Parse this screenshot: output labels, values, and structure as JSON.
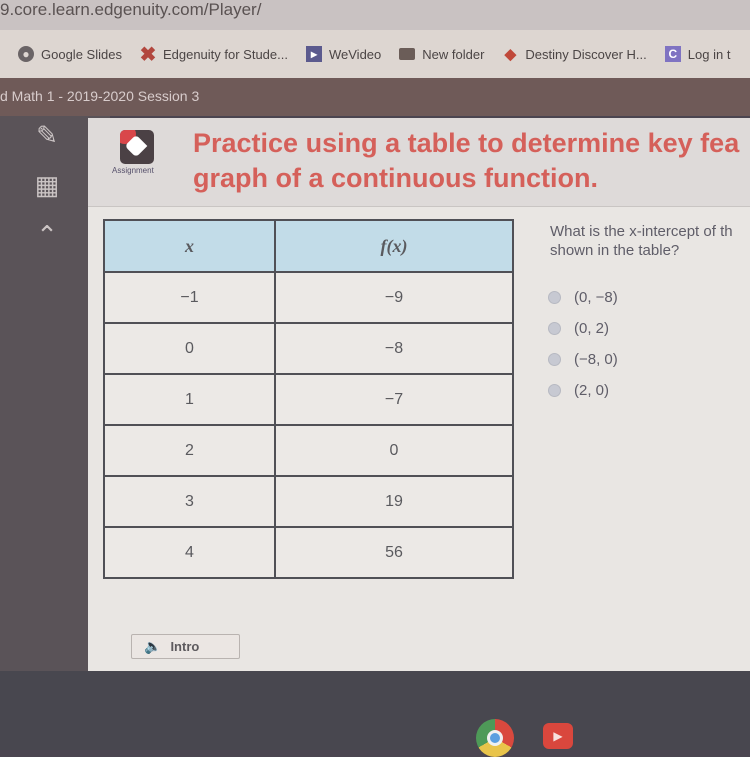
{
  "browser": {
    "url": "9.core.learn.edgenuity.com/Player/",
    "bookmarks": [
      {
        "label": "Google Slides",
        "icon": "google-slides-icon"
      },
      {
        "label": "Edgenuity for Stude...",
        "icon": "edgenuity-icon"
      },
      {
        "label": "WeVideo",
        "icon": "wevideo-icon"
      },
      {
        "label": "New folder",
        "icon": "folder-icon"
      },
      {
        "label": "Destiny Discover H...",
        "icon": "destiny-icon"
      },
      {
        "label": "Log in t",
        "icon": "clever-icon",
        "glyph": "C"
      }
    ]
  },
  "course": {
    "title": "d Math 1 - 2019-2020 Session 3"
  },
  "sidebar": {
    "tools": [
      "pencil-icon",
      "calculator-icon",
      "graph-icon"
    ]
  },
  "header": {
    "assignment_label": "Assignment",
    "title_line1": "Practice using a table to determine key fea",
    "title_line2": "graph of a continuous function."
  },
  "table": {
    "headers": [
      "x",
      "f(x)"
    ],
    "rows": [
      [
        "−1",
        "−9"
      ],
      [
        "0",
        "−8"
      ],
      [
        "1",
        "−7"
      ],
      [
        "2",
        "0"
      ],
      [
        "3",
        "19"
      ],
      [
        "4",
        "56"
      ]
    ]
  },
  "question": {
    "line1": "What is the x-intercept of th",
    "line2": "shown in the table?",
    "options": [
      "(0, −8)",
      "(0, 2)",
      "(−8, 0)",
      "(2, 0)"
    ]
  },
  "intro_button": {
    "label": "Intro"
  },
  "shelf": {
    "apps": [
      "chrome-icon",
      "youtube-icon"
    ]
  }
}
